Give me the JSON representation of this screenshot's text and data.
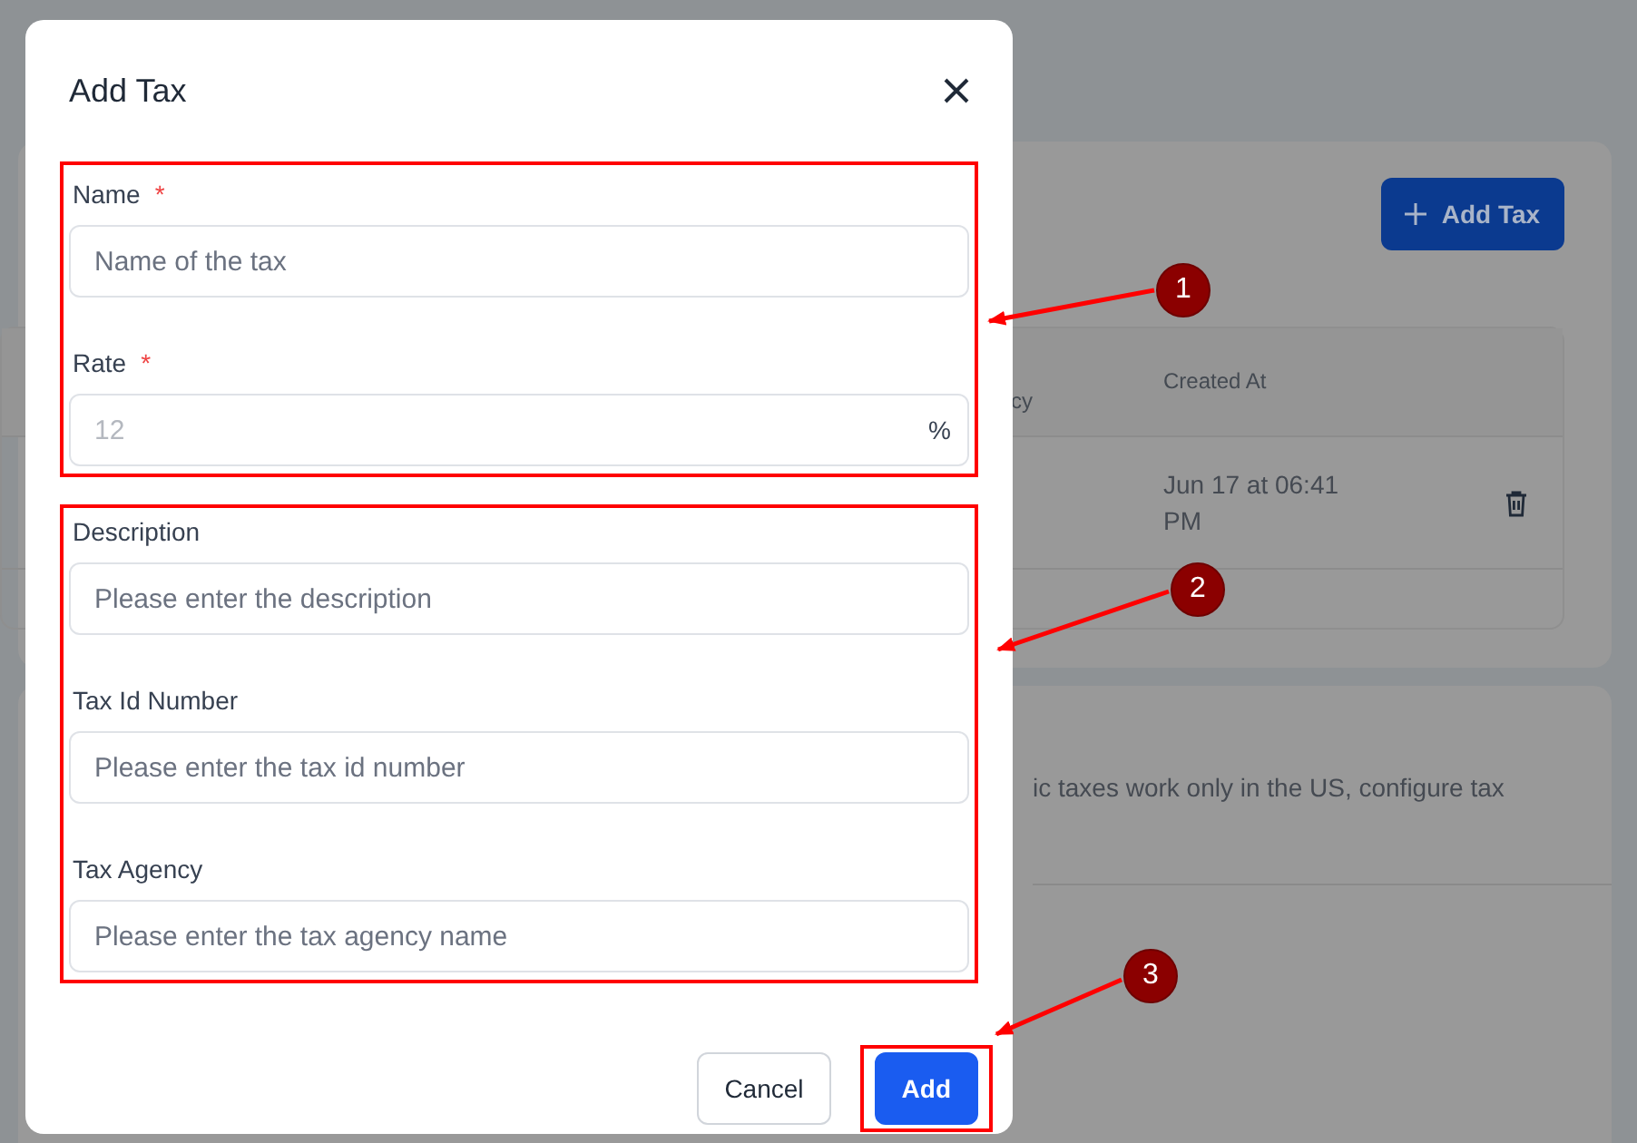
{
  "page": {
    "add_button": {
      "label": "Add Tax"
    },
    "table": {
      "columns": [
        "cy",
        "Created At"
      ],
      "rows": [
        {
          "created_at": "Jun 17 at 06:41 PM"
        }
      ]
    },
    "note": "ic taxes work only in the US, configure tax"
  },
  "modal": {
    "title": "Add Tax",
    "field_groups": [
      {
        "callout": "1",
        "fields": [
          {
            "label": "Name",
            "marker": "*",
            "placeholder": "Name of the tax",
            "kind": "text"
          },
          {
            "label": "Rate",
            "marker": "*",
            "placeholder": "12",
            "suffix": "%",
            "kind": "number"
          }
        ]
      },
      {
        "callout": "2",
        "fields": [
          {
            "label": "Description",
            "placeholder": "Please enter the description",
            "kind": "text"
          },
          {
            "label": "Tax Id Number",
            "placeholder": "Please enter the tax id number",
            "kind": "text"
          },
          {
            "label": "Tax Agency",
            "placeholder": "Please enter the tax agency name",
            "kind": "text"
          }
        ]
      }
    ],
    "buttons": [
      {
        "label": "Cancel",
        "kind": "secondary"
      },
      {
        "label": "Add",
        "kind": "primary",
        "callout": "3"
      }
    ]
  }
}
